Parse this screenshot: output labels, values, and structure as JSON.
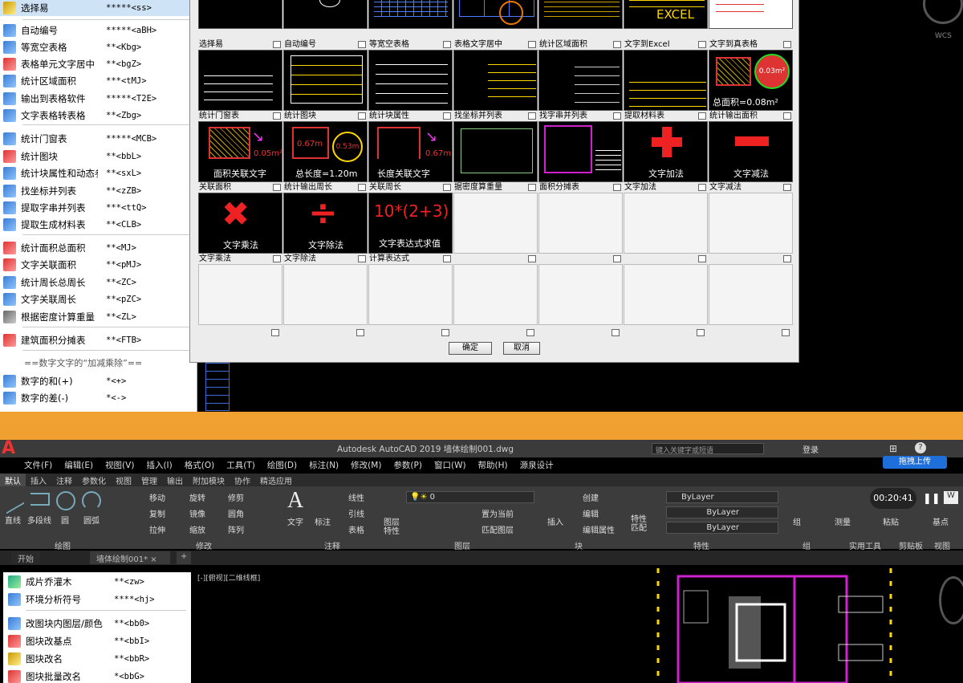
{
  "top_menu": {
    "items": [
      {
        "label": "选择易",
        "cmd": "*****<ss>"
      },
      {
        "label": "自动编号",
        "cmd": "*****<aBH>"
      },
      {
        "label": "等宽空表格",
        "cmd": "**<Kbg>"
      },
      {
        "label": "表格单元文字居中",
        "cmd": "**<bgZ>"
      },
      {
        "label": "统计区域面积",
        "cmd": "***<tMJ>"
      },
      {
        "label": "输出到表格软件",
        "cmd": "*****<T2E>"
      },
      {
        "label": "文字表格转表格",
        "cmd": "**<Zbg>"
      },
      {
        "label": "统计门窗表",
        "cmd": "*****<MCB>"
      },
      {
        "label": "统计图块",
        "cmd": "**<bbL>"
      },
      {
        "label": "统计块属性和动态参",
        "cmd": "**<sxL>"
      },
      {
        "label": "找坐标并列表",
        "cmd": "**<zZB>"
      },
      {
        "label": "提取字串并列表",
        "cmd": "***<ttQ>"
      },
      {
        "label": "提取生成材料表",
        "cmd": "**<CLB>"
      },
      {
        "label": "统计面积总面积",
        "cmd": "**<MJ>"
      },
      {
        "label": "文字关联面积",
        "cmd": "**<pMJ>"
      },
      {
        "label": "统计周长总周长",
        "cmd": "**<ZC>"
      },
      {
        "label": "文字关联周长",
        "cmd": "**<pZC>"
      },
      {
        "label": "根据密度计算重量",
        "cmd": "**<ZL>"
      },
      {
        "label": "建筑面积分摊表",
        "cmd": "**<FTB>"
      },
      {
        "label": "数字的和(+)",
        "cmd": "*<+>"
      },
      {
        "label": "数字的差(-)",
        "cmd": "*<->"
      }
    ],
    "section_label": "==数字文字的“加减乘除”=="
  },
  "dialog": {
    "captions": [
      "选择易",
      "自动编号",
      "等宽空表格",
      "表格文字居中",
      "统计区域面积",
      "文字到Excel",
      "文字到真表格",
      "统计门窗表",
      "统计图块",
      "统计块属性",
      "找坐标并列表",
      "找字串并列表",
      "提取材料表",
      "统计输出面积",
      "关联面积",
      "统计输出周长",
      "关联周长",
      "据密度算重量",
      "面积分摊表",
      "文字加法",
      "文字减法",
      "文字乘法",
      "文字除法",
      "计算表达式",
      "",
      "",
      "",
      ""
    ],
    "thumb_texts": {
      "area_text": "面积关联文字",
      "area_val": "0.05m²",
      "len_text": "总长度=1.20m",
      "len_val1": "0.67m",
      "len_val2": "0.53m",
      "len_assoc": "长度关联文字",
      "len_val3": "0.67m",
      "add_text": "文字加法",
      "sub_text": "文字减法",
      "mul_text": "文字乘法",
      "div_text": "文字除法",
      "expr": "10*(2+3)",
      "expr_text": "文字表达式求值",
      "total_area": "总面积=0.08m²",
      "area2": "0.03m²",
      "excel": "EXCEL"
    },
    "ok_label": "确定",
    "cancel_label": "取消"
  },
  "autocad": {
    "title": "Autodesk AutoCAD 2019   墙体绘制001.dwg",
    "search_placeholder": "键入关键字或短语",
    "login": "登录",
    "menus": [
      "文件(F)",
      "编辑(E)",
      "视图(V)",
      "插入(I)",
      "格式(O)",
      "工具(T)",
      "绘图(D)",
      "标注(N)",
      "修改(M)",
      "参数(P)",
      "窗口(W)",
      "帮助(H)",
      "源泉设计"
    ],
    "ribbon_tabs": [
      "默认",
      "插入",
      "注释",
      "参数化",
      "视图",
      "管理",
      "输出",
      "附加模块",
      "协作",
      "精选应用"
    ],
    "panels": [
      "绘图",
      "修改",
      "注释",
      "图层",
      "块",
      "特性",
      "组",
      "实用工具",
      "剪贴板",
      "视图"
    ],
    "draw_tools": [
      "直线",
      "多段线",
      "圆",
      "圆弧"
    ],
    "modify_tools": [
      "移动",
      "旋转",
      "修剪",
      "复制",
      "镜像",
      "圆角",
      "拉伸",
      "缩放",
      "阵列"
    ],
    "annot_tools": [
      "文字",
      "标注",
      "线性",
      "引线",
      "表格"
    ],
    "layer_tools": [
      "图层特性",
      "置为当前",
      "匹配图层"
    ],
    "block_tools": [
      "插入",
      "创建",
      "编辑",
      "编辑属性"
    ],
    "prop_tools": [
      "特性匹配",
      "ByLayer",
      "ByLayer",
      "ByLayer"
    ],
    "layer_value": "0",
    "other_tools": [
      "组",
      "测量",
      "粘贴",
      "基点"
    ],
    "upload": "拖拽上传",
    "timer": "00:20:41",
    "doc_tabs": [
      "开始",
      "墙体绘制001*"
    ],
    "view_label": "[-][俯视][二维线框]",
    "wcs": "WCS",
    "bottom_menu": [
      {
        "label": "成片乔灌木",
        "cmd": "**<zw>"
      },
      {
        "label": "环境分析符号",
        "cmd": "****<hj>"
      },
      {
        "label": "改图块内图层/颜色",
        "cmd": "**<bb0>"
      },
      {
        "label": "图块改基点",
        "cmd": "**<bbI>"
      },
      {
        "label": "图块改名",
        "cmd": "**<bbR>"
      },
      {
        "label": "图块批量改名",
        "cmd": "*<bbG>"
      }
    ]
  },
  "colors": {
    "accent": "#f0a030",
    "cad_bg": "#000000",
    "magenta": "#d020d0",
    "yellow": "#ffd700"
  }
}
